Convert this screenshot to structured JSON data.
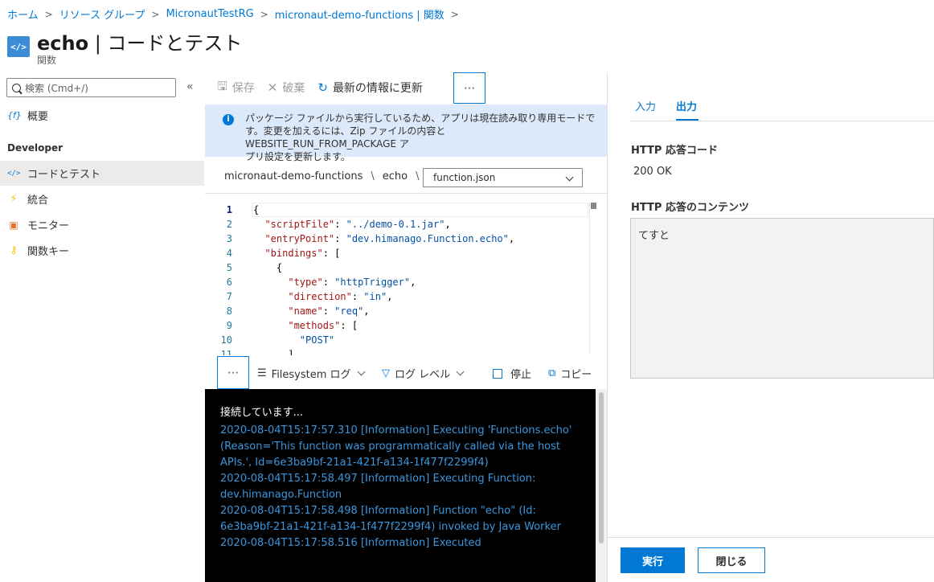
{
  "breadcrumb": [
    "ホーム",
    "リソース グループ",
    "MicronautTestRG",
    "micronaut-demo-functions | 関数"
  ],
  "title": {
    "name": "echo",
    "suffix": " | コードとテスト",
    "subtitle": "関数",
    "icon": "code-icon"
  },
  "sidebar": {
    "search_placeholder": "検索 (Cmd+/)",
    "overview": {
      "label": "概要",
      "icon": "function-icon"
    },
    "section": "Developer",
    "items": [
      {
        "label": "コードとテスト",
        "icon": "code-icon",
        "active": true
      },
      {
        "label": "統合",
        "icon": "lightning-icon"
      },
      {
        "label": "モニター",
        "icon": "monitor-icon"
      },
      {
        "label": "関数キー",
        "icon": "key-icon"
      }
    ]
  },
  "toolbar": {
    "save": "保存",
    "discard": "破棄",
    "refresh": "最新の情報に更新",
    "more": "···"
  },
  "info": {
    "line1": "パッケージ ファイルから実行しているため、アプリは現在読み取り専用モードで",
    "line2": "す。変更を加えるには、Zip ファイルの内容と WEBSITE_RUN_FROM_PACKAGE ア",
    "line3": "プリ設定を更新します。"
  },
  "path": {
    "app": "micronaut-demo-functions",
    "sep": "\\",
    "function": "echo",
    "file": "function.json"
  },
  "code": [
    {
      "n": "1",
      "t": "{"
    },
    {
      "n": "2",
      "t": "  \"scriptFile\": \"../demo-0.1.jar\","
    },
    {
      "n": "3",
      "t": "  \"entryPoint\": \"dev.himanago.Function.echo\","
    },
    {
      "n": "4",
      "t": "  \"bindings\": ["
    },
    {
      "n": "5",
      "t": "    {"
    },
    {
      "n": "6",
      "t": "      \"type\": \"httpTrigger\","
    },
    {
      "n": "7",
      "t": "      \"direction\": \"in\","
    },
    {
      "n": "8",
      "t": "      \"name\": \"req\","
    },
    {
      "n": "9",
      "t": "      \"methods\": ["
    },
    {
      "n": "10",
      "t": "        \"POST\""
    },
    {
      "n": "11",
      "t": "      ],"
    }
  ],
  "log_toolbar": {
    "more": "···",
    "source": "Filesystem ログ",
    "level": "ログ レベル",
    "stop": "停止",
    "copy": "コピー"
  },
  "log": {
    "status": "接続しています...",
    "entries": "2020-08-04T15:17:57.310 [Information] Executing 'Functions.echo' (Reason='This function was programmatically called via the host APIs.', Id=6e3ba9bf-21a1-421f-a134-1f477f2299f4)\n2020-08-04T15:17:58.497 [Information] Executing Function: dev.himanago.Function\n2020-08-04T15:17:58.498 [Information] Function \"echo\" (Id: 6e3ba9bf-21a1-421f-a134-1f477f2299f4) invoked by Java Worker\n2020-08-04T15:17:58.516 [Information] Executed"
  },
  "panel": {
    "tab_input": "入力",
    "tab_output": "出力",
    "active_tab": "出力",
    "code_label": "HTTP 応答コード",
    "code_value": "200 OK",
    "content_label": "HTTP 応答のコンテンツ",
    "content_value": "てすと",
    "run": "実行",
    "close": "閉じる"
  },
  "colors": {
    "accent": "#0078d4",
    "info_bg": "#dce9fa",
    "log_bg": "#000000",
    "log_text": "#3a96dd"
  }
}
